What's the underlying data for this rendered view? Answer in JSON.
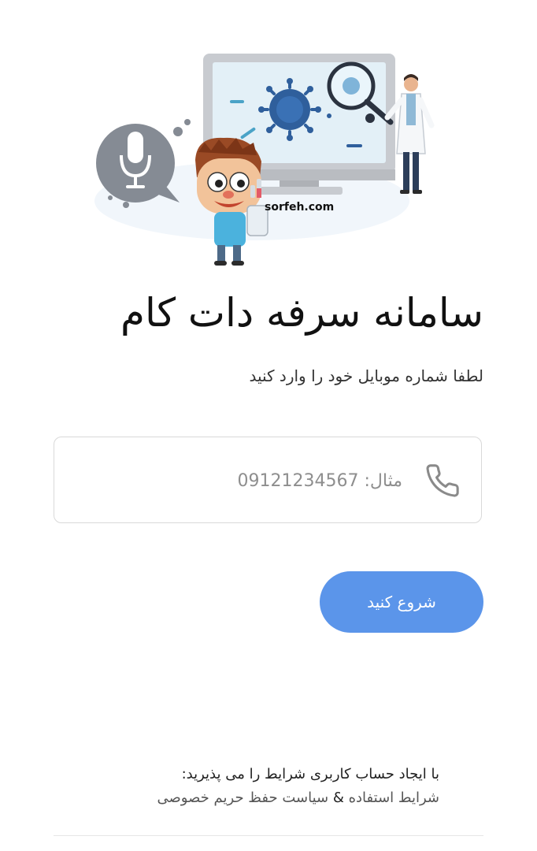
{
  "app": {
    "title": "سامانه سرفه دات کام",
    "subtitle": "لطفا شماره موبایل خود را وارد کنید"
  },
  "hero": {
    "watermark": "sorfeh.com",
    "icons": [
      "microphone-icon",
      "virus-icon",
      "magnifier-icon",
      "doctor-figure",
      "cartoon-boy-figure"
    ]
  },
  "phone_field": {
    "icon": "phone-icon",
    "value": "",
    "placeholder": "مثال: 09121234567"
  },
  "start_button": {
    "label": "شروع کنید"
  },
  "terms": {
    "line1": "با ایجاد حساب کاربری شرایط را می پذیرید:",
    "terms_link": "شرایط استفاده",
    "ampersand": "&",
    "privacy_link": "سیاست حفظ حریم خصوصی"
  },
  "colors": {
    "accent": "#5b95ea",
    "field_border": "#d9d9d9",
    "monitor_frame": "#c8cbd0",
    "virus": "#2f5f9c"
  }
}
